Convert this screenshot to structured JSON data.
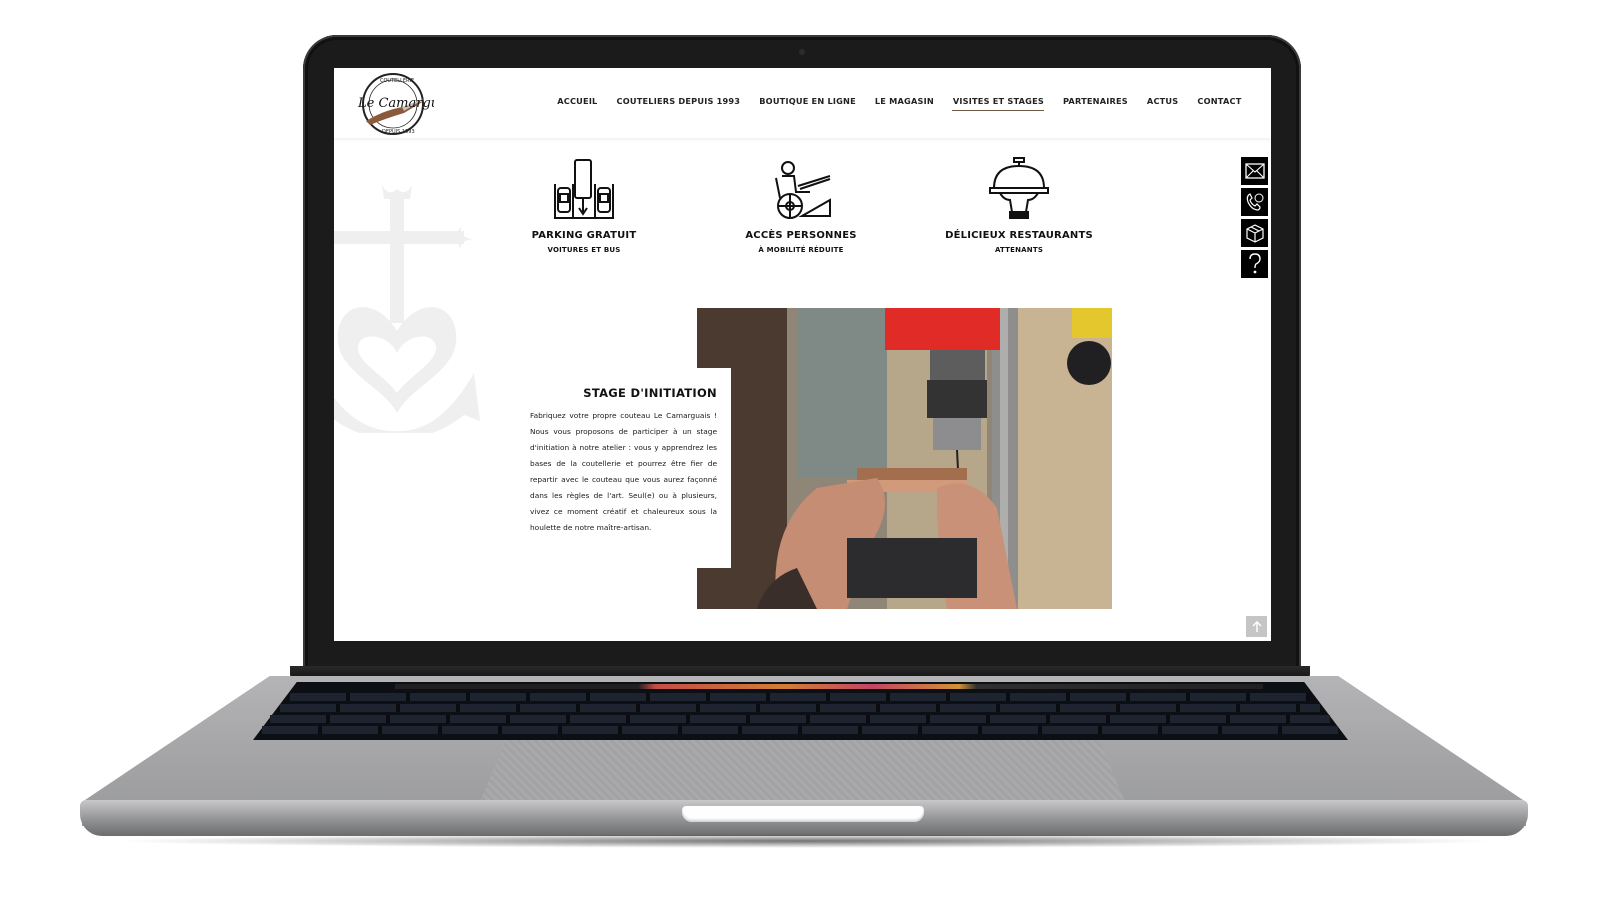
{
  "site": {
    "logo_text": "Le Camarguais",
    "logo_ring_top": "COUTELLERIE",
    "logo_ring_bottom": "DEPUIS 1993"
  },
  "nav": {
    "items": [
      {
        "label": "ACCUEIL",
        "active": false
      },
      {
        "label": "COUTELIERS DEPUIS 1993",
        "active": false
      },
      {
        "label": "BOUTIQUE EN LIGNE",
        "active": false
      },
      {
        "label": "LE MAGASIN",
        "active": false
      },
      {
        "label": "VISITES ET STAGES",
        "active": true
      },
      {
        "label": "PARTENAIRES",
        "active": false
      },
      {
        "label": "ACTUS",
        "active": false
      },
      {
        "label": "CONTACT",
        "active": false
      }
    ]
  },
  "features": [
    {
      "icon": "parking-icon",
      "title": "PARKING GRATUIT",
      "subtitle": "VOITURES ET BUS"
    },
    {
      "icon": "wheelchair-icon",
      "title": "ACCÈS PERSONNES",
      "subtitle": "À MOBILITÉ RÉDUITE"
    },
    {
      "icon": "cloche-icon",
      "title": "DÉLICIEUX RESTAURANTS",
      "subtitle": "ATTENANTS"
    }
  ],
  "stage": {
    "title": "STAGE D'INITIATION",
    "body": "Fabriquez votre propre couteau Le Camarguais ! Nous vous proposons de participer à un stage d'initiation à notre atelier : vous y apprendrez les bases de la coutellerie et pourrez être fier de repartir avec le couteau que vous aurez façonné dans les règles de l'art. Seul(e) ou à plusieurs, vivez ce moment créatif et chaleureux sous la houlette de notre maître-artisan.",
    "photo_alt": "Artisan drilling a knife handle on a drill press"
  },
  "side_tools": [
    {
      "icon": "mail-icon",
      "label": "Email"
    },
    {
      "icon": "phone-icon",
      "label": "Phone"
    },
    {
      "icon": "box-icon",
      "label": "Shop"
    },
    {
      "icon": "question-icon",
      "label": "Help"
    }
  ],
  "scroll_top_icon": "arrow-up-icon",
  "colors": {
    "nav_active_underline": "#6e5a44",
    "text": "#111111",
    "side_tool_bg": "#000000",
    "watermark": "#f0f0f0"
  }
}
